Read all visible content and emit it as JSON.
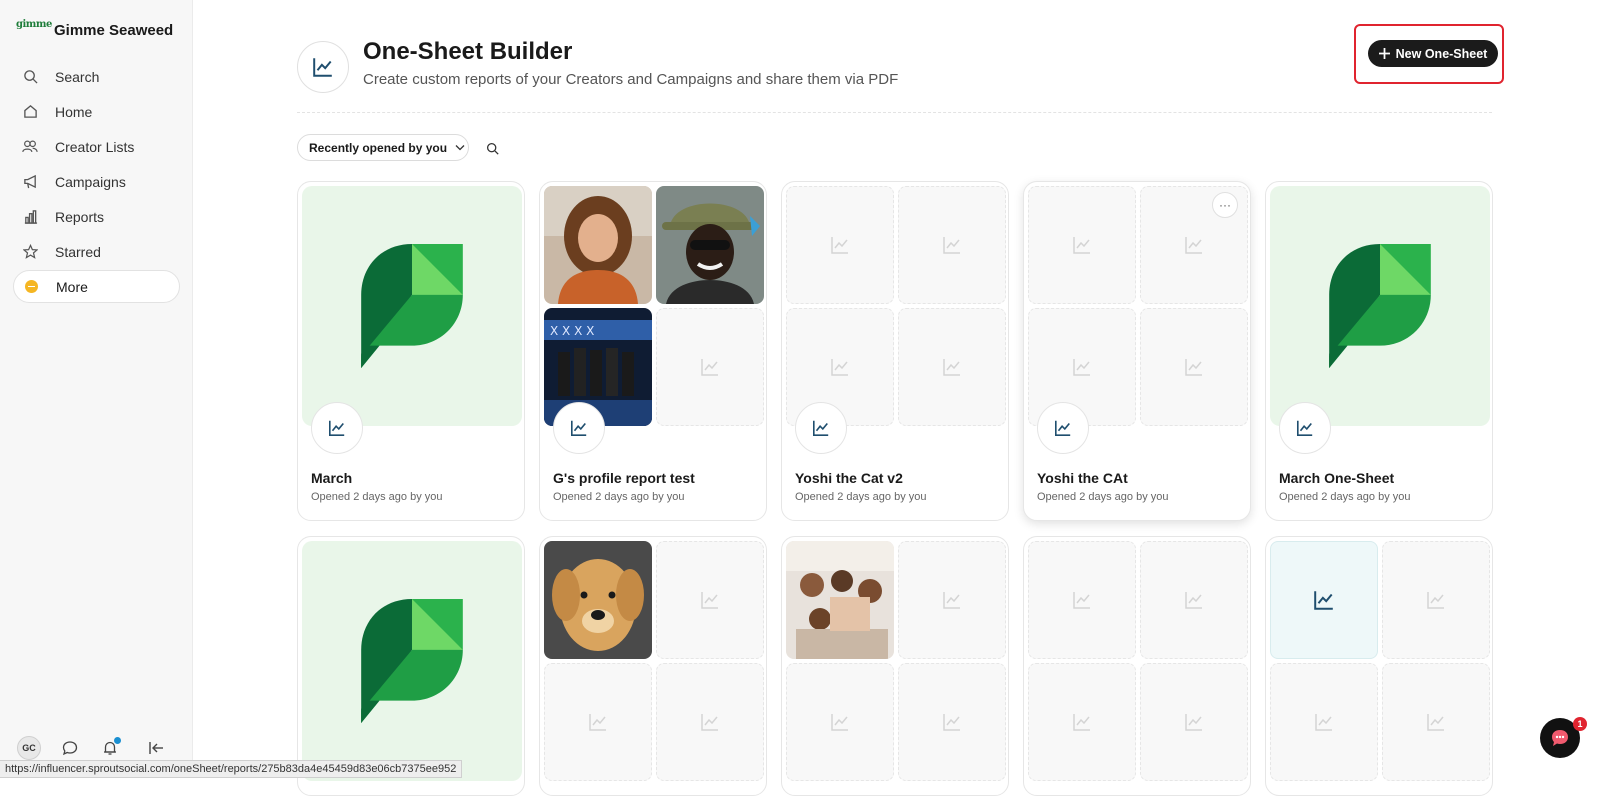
{
  "brand": {
    "name": "Gimme Seaweed",
    "logo_text": "gimme"
  },
  "sidebar": {
    "items": [
      {
        "label": "Search",
        "icon": "search-icon"
      },
      {
        "label": "Home",
        "icon": "home-icon"
      },
      {
        "label": "Creator Lists",
        "icon": "users-icon"
      },
      {
        "label": "Campaigns",
        "icon": "megaphone-icon"
      },
      {
        "label": "Reports",
        "icon": "bar-chart-icon"
      },
      {
        "label": "Starred",
        "icon": "star-icon"
      },
      {
        "label": "More",
        "icon": "more-icon"
      }
    ],
    "avatar_initials": "GC"
  },
  "header": {
    "title": "One-Sheet Builder",
    "subtitle": "Create custom reports of your Creators and Campaigns and share them via PDF",
    "new_button": "New One-Sheet"
  },
  "filter": {
    "label": "Recently opened by you"
  },
  "cards": [
    {
      "title": "March",
      "subtitle": "Opened 2 days ago by you"
    },
    {
      "title": "G's profile report test",
      "subtitle": "Opened 2 days ago by you"
    },
    {
      "title": "Yoshi the Cat v2",
      "subtitle": "Opened 2 days ago by you"
    },
    {
      "title": "Yoshi the CAt",
      "subtitle": "Opened 2 days ago by you"
    },
    {
      "title": "March One-Sheet",
      "subtitle": "Opened 2 days ago by you"
    }
  ],
  "kebab_label": "···",
  "status_url": "https://influencer.sproutsocial.com/oneSheet/reports/275b83da4e45459d83e06cb7375ee952",
  "chat_badge": "1",
  "colors": {
    "accent_green": "#2bb24c",
    "dark_green": "#0b6b37",
    "light_green": "#6ed866",
    "highlight_red": "#e0242f"
  }
}
